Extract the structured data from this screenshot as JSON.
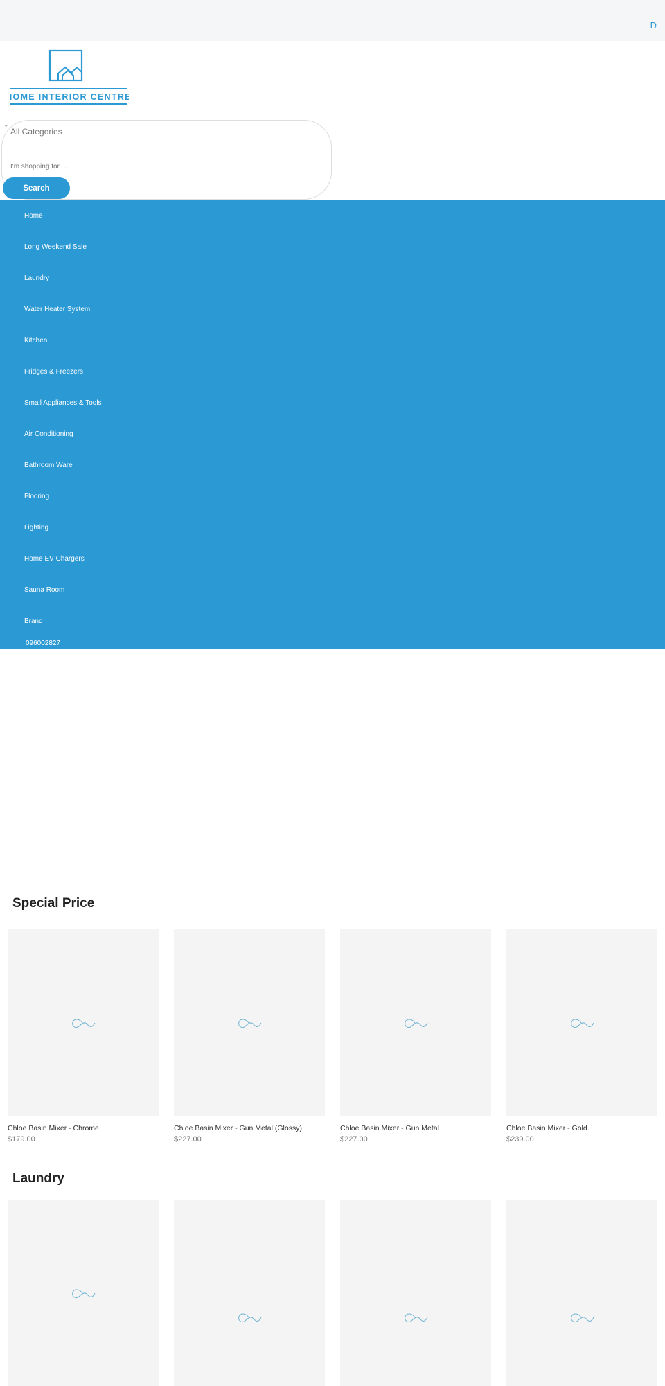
{
  "topbar": {
    "right_label": "D"
  },
  "logo": {
    "text": "HOME INTERIOR CENTRE"
  },
  "search": {
    "category": "All Categories",
    "placeholder": "I'm shopping for ...",
    "button": "Search"
  },
  "nav": {
    "items": [
      "Home",
      "Long Weekend Sale",
      "Laundry",
      "Water Heater System",
      "Kitchen",
      "Fridges & Freezers",
      "Small Appliances & Tools",
      "Air Conditioning",
      "Bathroom Ware",
      "Flooring",
      "Lighting",
      "Home EV Chargers",
      "Sauna Room",
      "Brand"
    ],
    "phone": "096002827"
  },
  "sections": [
    {
      "title": "Special Price",
      "products": [
        {
          "name": "Chloe Basin Mixer - Chrome",
          "price": "$179.00"
        },
        {
          "name": "Chloe Basin Mixer - Gun Metal (Glossy)",
          "price": "$227.00"
        },
        {
          "name": "Chloe Basin Mixer - Gun Metal",
          "price": "$227.00"
        },
        {
          "name": "Chloe Basin Mixer - Gold",
          "price": "$239.00"
        }
      ]
    },
    {
      "title": "Laundry",
      "products": [
        {},
        {},
        {},
        {}
      ]
    }
  ],
  "colors": {
    "brand": "#2a99d4",
    "topbar": "#f5f6f8"
  }
}
